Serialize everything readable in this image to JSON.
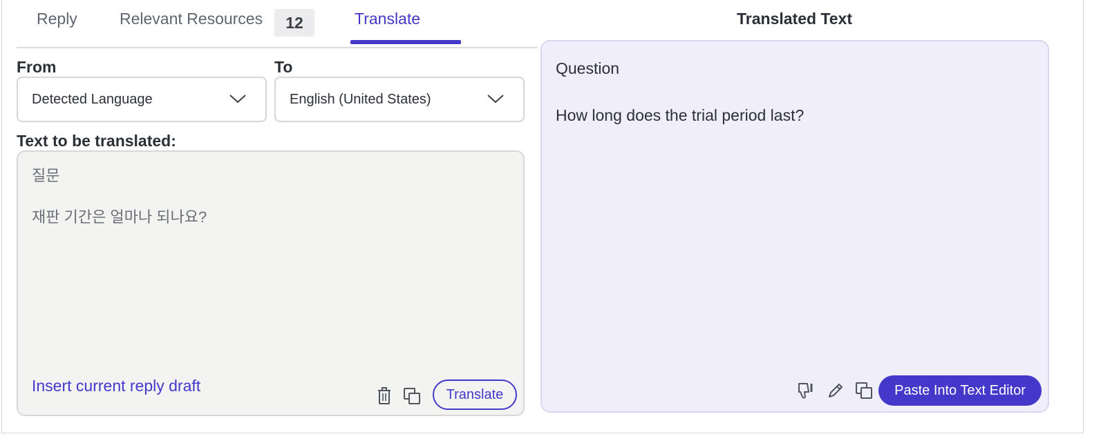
{
  "tabs": [
    {
      "label": "Reply"
    },
    {
      "label": "Relevant Resources",
      "count": "12"
    },
    {
      "label": "Translate",
      "active": true
    }
  ],
  "from": {
    "label": "From",
    "value": "Detected Language"
  },
  "to": {
    "label": "To",
    "value": "English (United States)"
  },
  "source": {
    "label": "Text to be translated:",
    "text": "질문\n\n재판 기간은 얼마나 되나요?",
    "insert_link": "Insert current reply draft",
    "translate_button": "Translate"
  },
  "target": {
    "title": "Translated Text",
    "text": "Question\n\nHow long does the trial period last?",
    "paste_button": "Paste Into Text Editor"
  },
  "colors": {
    "accent": "#4338ca",
    "target_bg": "#f0eefb",
    "source_bg": "#f3f3f2"
  },
  "icons": [
    "chevron-down-icon",
    "trash-icon",
    "copy-icon",
    "thumbs-down-icon",
    "pencil-icon"
  ]
}
